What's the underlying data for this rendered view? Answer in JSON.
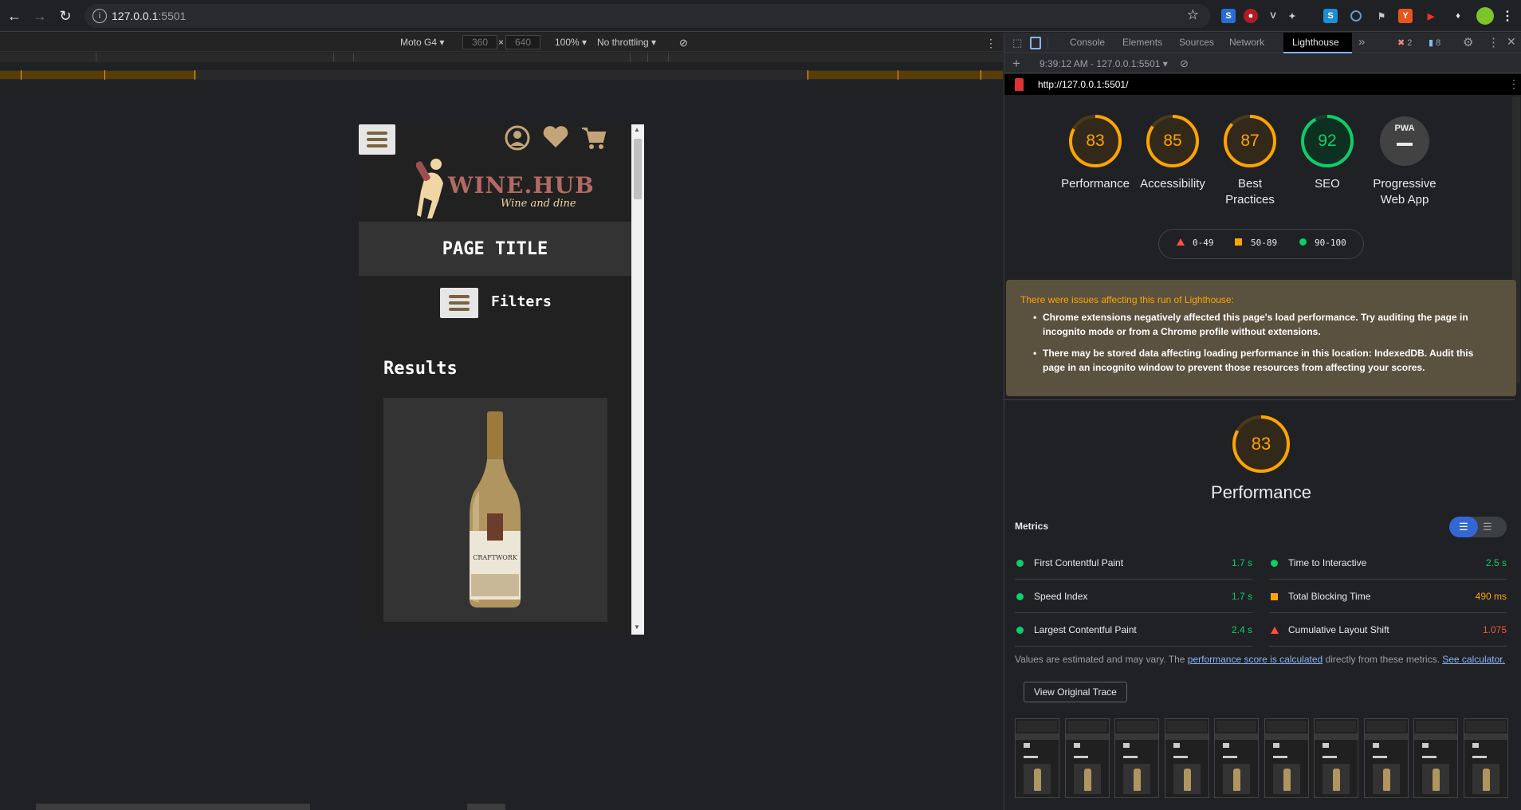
{
  "browser": {
    "url_host": "127.0.0.1",
    "url_port": ":5501"
  },
  "device_toolbar": {
    "device": "Moto G4",
    "width": "360",
    "height": "640",
    "zoom": "100%",
    "throttling": "No throttling"
  },
  "site": {
    "logo_title": "WINE.HUB",
    "logo_subtitle": "Wine and dine",
    "page_title": "PAGE TITLE",
    "filters_label": "Filters",
    "results_heading": "Results",
    "bottle_label": "CRAFTWORK"
  },
  "devtools": {
    "tabs": [
      "Console",
      "Elements",
      "Sources",
      "Network",
      "Lighthouse"
    ],
    "active_tab": "Lighthouse",
    "error_count": "2",
    "message_count": "8",
    "report_select": "9:39:12 AM - 127.0.0.1:5501",
    "report_url": "http://127.0.0.1:5501/"
  },
  "lighthouse": {
    "scores": [
      {
        "label_line1": "Performance",
        "label_line2": "",
        "value": 83,
        "color": "#ffa400"
      },
      {
        "label_line1": "Accessibility",
        "label_line2": "",
        "value": 85,
        "color": "#ffa400"
      },
      {
        "label_line1": "Best",
        "label_line2": "Practices",
        "value": 87,
        "color": "#ffa400"
      },
      {
        "label_line1": "SEO",
        "label_line2": "",
        "value": 92,
        "color": "#0cce6b"
      },
      {
        "label_line1": "Progressive",
        "label_line2": "Web App",
        "value": null,
        "color": "#9aa0a6",
        "badge": "PWA"
      }
    ],
    "legend": {
      "fail": "0-49",
      "average": "50-89",
      "pass": "90-100"
    },
    "warning_title": "There were issues affecting this run of Lighthouse:",
    "warnings": [
      "Chrome extensions negatively affected this page's load performance. Try auditing the page in incognito mode or from a Chrome profile without extensions.",
      "There may be stored data affecting loading performance in this location: IndexedDB. Audit this page in an incognito window to prevent those resources from affecting your scores."
    ],
    "perf_score": "83",
    "perf_title": "Performance",
    "metrics_title": "Metrics",
    "metrics": [
      {
        "name": "First Contentful Paint",
        "value": "1.7 s",
        "status": "pass"
      },
      {
        "name": "Time to Interactive",
        "value": "2.5 s",
        "status": "pass"
      },
      {
        "name": "Speed Index",
        "value": "1.7 s",
        "status": "pass"
      },
      {
        "name": "Total Blocking Time",
        "value": "490 ms",
        "status": "average"
      },
      {
        "name": "Largest Contentful Paint",
        "value": "2.4 s",
        "status": "pass"
      },
      {
        "name": "Cumulative Layout Shift",
        "value": "1.075",
        "status": "fail"
      }
    ],
    "note_prefix": "Values are estimated and may vary. The ",
    "note_link1": "performance score is calculated",
    "note_middle": " directly from these metrics. ",
    "note_link2": "See calculator.",
    "view_trace": "View Original Trace"
  },
  "colors": {
    "pass": "#0cce6b",
    "average": "#ffa400",
    "fail": "#ff4e42",
    "accent": "#3367d6"
  }
}
